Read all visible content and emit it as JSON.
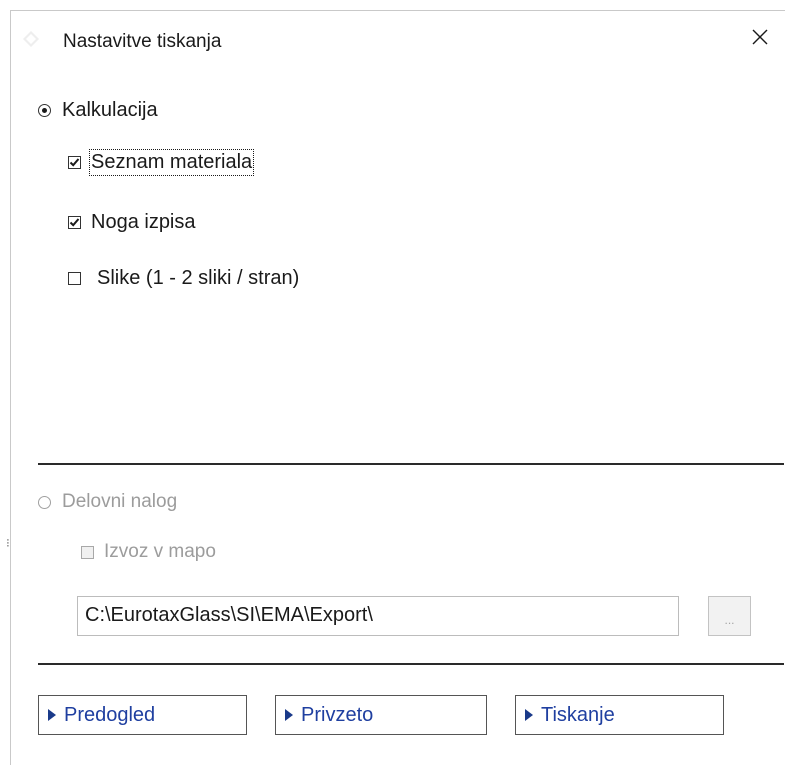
{
  "window": {
    "title": "Nastavitve tiskanja",
    "close_icon": "close-icon",
    "app_icon": "diamond-app-icon"
  },
  "calculation": {
    "label": "Kalkulacija",
    "selected": true,
    "options": [
      {
        "label": "Seznam materiala",
        "checked": true,
        "focused": true
      },
      {
        "label": "Noga izpisa",
        "checked": true
      },
      {
        "label": "Slike (1 - 2 sliki / stran)",
        "checked": false
      }
    ]
  },
  "work_order": {
    "label": "Delovni nalog",
    "selected": false,
    "enabled": false,
    "export_label": "Izvoz v mapo",
    "export_checked": false,
    "path_value": "C:\\EurotaxGlass\\SI\\EMA\\Export\\",
    "browse_label": "..."
  },
  "actions": {
    "preview": "Predogled",
    "default": "Privzeto",
    "print": "Tiskanje"
  },
  "colors": {
    "link_blue": "#1f3fa0",
    "disabled_text": "#9c9c9c"
  }
}
